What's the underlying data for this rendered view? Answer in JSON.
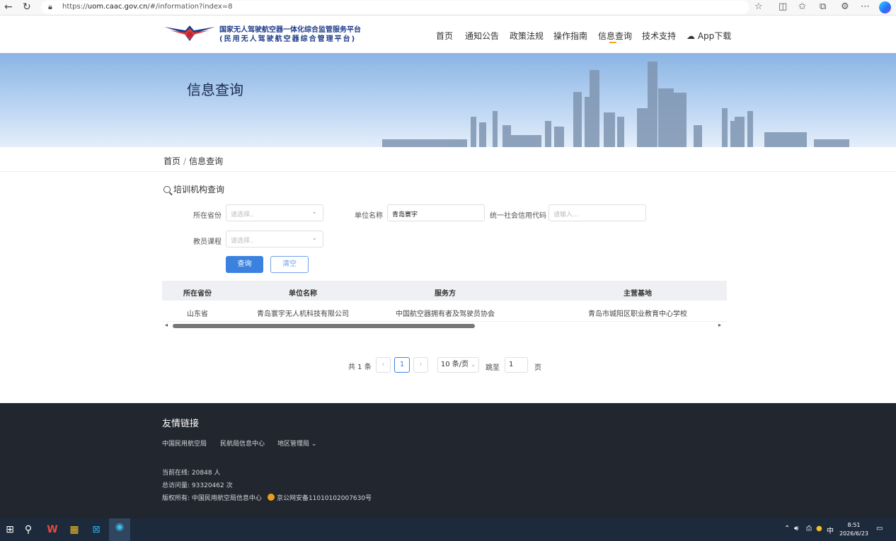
{
  "browser": {
    "url_prefix": "https://",
    "url_domain": "uom.caac.gov.cn",
    "url_path": "/#/information?index=8"
  },
  "header": {
    "logo_line1": "国家无人驾驶航空器一体化综合监管服务平台",
    "logo_line2": "(民用无人驾驶航空器综合管理平台)",
    "menu": [
      {
        "label": "首页"
      },
      {
        "label": "通知公告"
      },
      {
        "label": "政策法规"
      },
      {
        "label": "操作指南"
      },
      {
        "label": "信息查询"
      },
      {
        "label": "技术支持"
      },
      {
        "label": "App下载"
      }
    ],
    "active_menu": "信息查询"
  },
  "banner": {
    "title": "信息查询"
  },
  "breadcrumb": {
    "home": "首页",
    "separator": "/",
    "current": "信息查询"
  },
  "query": {
    "title": "培训机构查询",
    "province_label": "所在省份",
    "province_placeholder": "请选择..",
    "unit_label": "单位名称",
    "unit_value": "青岛寰宇",
    "credit_label": "统一社会信用代码",
    "credit_placeholder": "请输入...",
    "course_label": "教员课程",
    "course_placeholder": "请选择..",
    "search_button": "查询",
    "clear_button": "清空"
  },
  "table": {
    "headers": [
      "所在省份",
      "单位名称",
      "服务方",
      "主营基地"
    ],
    "rows": [
      [
        "山东省",
        "青岛寰宇无人机科技有限公司",
        "中国航空器拥有者及驾驶员协会",
        "青岛市城阳区职业教育中心学校"
      ]
    ]
  },
  "pagination": {
    "total": "共 1 条",
    "current_page": "1",
    "page_size": "10 条/页",
    "goto_label": "跳至",
    "goto_value": "1",
    "page_suffix": "页"
  },
  "footer": {
    "links_title": "友情链接",
    "links": [
      "中国民用航空局",
      "民航局信息中心",
      "地区管理局"
    ],
    "online_label": "当前在线:",
    "online_value": "20848 人",
    "visits_label": "总访问量:",
    "visits_value": "93320462 次",
    "copyright_label": "版权所有:",
    "copyright_value": "中国民用航空局信息中心",
    "icp": "京公网安备11010102007630号"
  },
  "taskbar": {
    "time": "8:51",
    "date": "2026/6/23",
    "ime": "中"
  },
  "colors": {
    "primary": "#3b82e0",
    "footer_bg": "#22262e",
    "accent": "#f5a623"
  }
}
